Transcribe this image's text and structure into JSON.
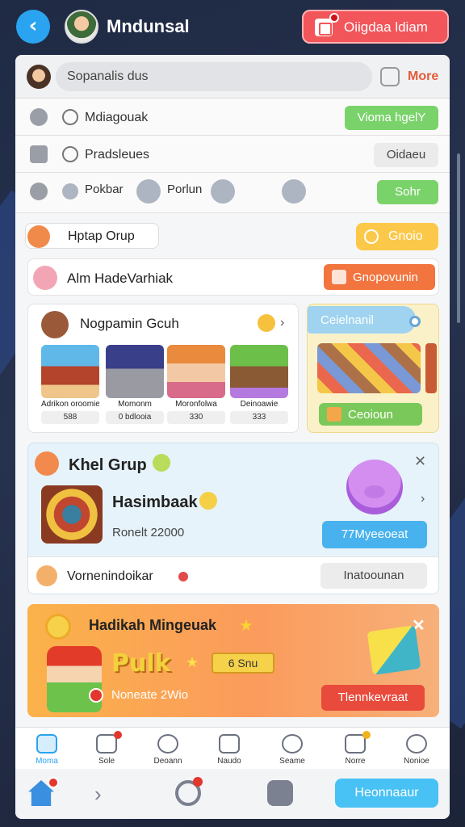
{
  "header": {
    "title": "Mndunsal",
    "action_label": "Oiigdaa ldiam"
  },
  "search": {
    "placeholder": "Sopanalis dus",
    "more_label": "More"
  },
  "rows": [
    {
      "label": "Mdiagouak",
      "button": "Vioma hgelY"
    },
    {
      "label": "Pradsleues",
      "button": "Oidaeu"
    },
    {
      "chips": [
        "Pokbar",
        "Porlun"
      ],
      "button": "Sohr"
    }
  ],
  "section": {
    "title": "Hptap Orup",
    "button": "Gnoio"
  },
  "invite": {
    "text": "Alm HadeVarhiak",
    "button": "Gnopovunin"
  },
  "games": {
    "title": "Nogpamin Gcuh",
    "tiles": [
      {
        "name": "Adrikon oroomie",
        "score": "588"
      },
      {
        "name": "Momonm",
        "score": "0 bdlooia"
      },
      {
        "name": "Moronfolwa",
        "score": "330"
      },
      {
        "name": "Deinoawie",
        "score": "333"
      }
    ]
  },
  "featured": {
    "title": "Ceielnanil",
    "button": "Ceoioun"
  },
  "group": {
    "title": "Khel Grup",
    "game_title": "Hasimbaak",
    "meta": "Ronelt 22000",
    "button": "77Myeeoeat",
    "footer_text": "Vornenindoikar",
    "footer_button": "Inatoounan"
  },
  "promo": {
    "title": "Hadikah Mingeuak",
    "brand": "Pulk",
    "tag": "6 Snu",
    "meta": "Noneate 2Wio",
    "button": "Tlennkevraat"
  },
  "tabs": [
    {
      "label": "Moma",
      "active": true
    },
    {
      "label": "Sole",
      "active": false
    },
    {
      "label": "Deoann",
      "active": false
    },
    {
      "label": "Naudo",
      "active": false
    },
    {
      "label": "Seame",
      "active": false
    },
    {
      "label": "Norre",
      "active": false
    },
    {
      "label": "Nonioe",
      "active": false
    }
  ],
  "bottom": {
    "button": "Heonnaaur"
  },
  "colors": {
    "accent": "#2aa3f0",
    "danger": "#f2555a",
    "success": "#7ad36a",
    "warning": "#fcc84a"
  }
}
